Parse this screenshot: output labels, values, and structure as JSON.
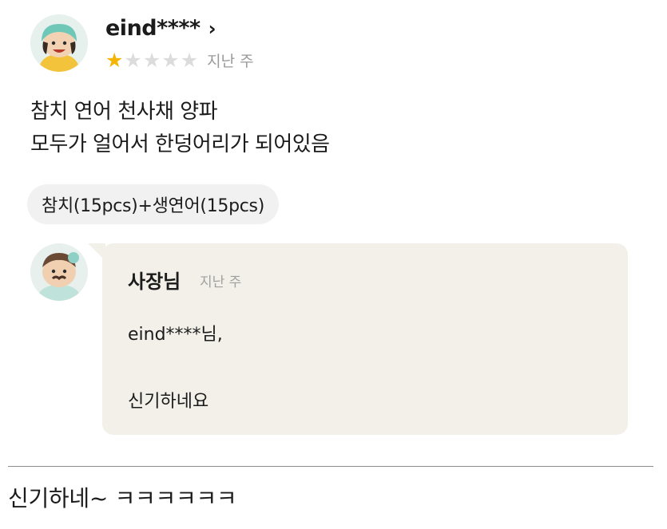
{
  "review": {
    "username": "eind****",
    "rating": 1,
    "rating_max": 5,
    "date": "지난 주",
    "text_lines": [
      "참치 연어 천사채 양파",
      "모두가 얼어서 한덩어리가 되어있음"
    ],
    "menu": "참치(15pcs)+생연어(15pcs)"
  },
  "reply": {
    "author": "사장님",
    "date": "지난 주",
    "line1": "eind****님,",
    "line2": "신기하네요"
  },
  "caption": "신기하네~ ㅋㅋㅋㅋㅋㅋ",
  "colors": {
    "star": "#f5b400",
    "reply_bg": "#f2f0e9"
  },
  "icons": {
    "profile_arrow": "chevron-right-icon",
    "star": "star-icon"
  }
}
